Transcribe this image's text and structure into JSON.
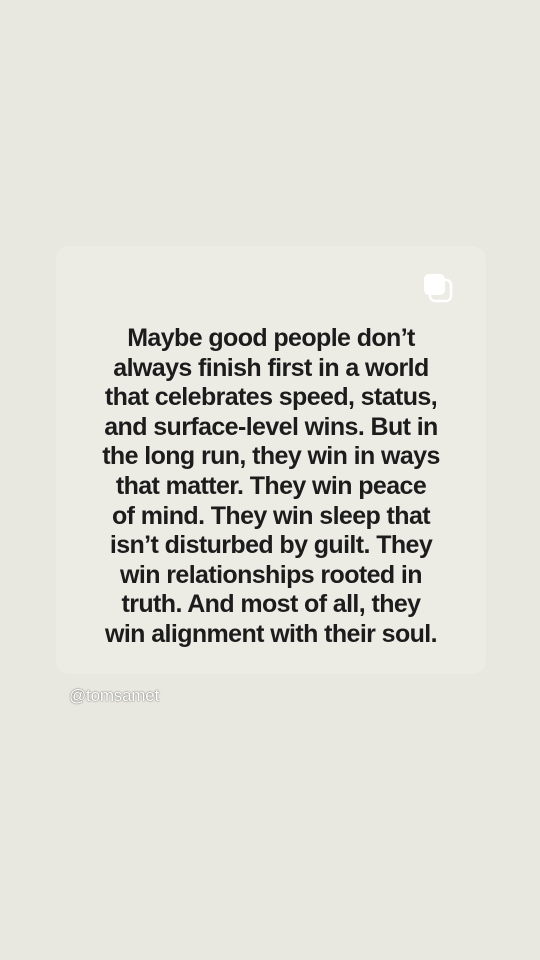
{
  "post": {
    "carousel_icon": "multiple-images-icon",
    "quote_lines": [
      "Maybe good people don’t",
      "always finish first in a world",
      "that celebrates speed, status,",
      "and surface-level wins. But in",
      "the long run, they win in ways",
      "that matter. They win peace",
      "of mind. They win sleep that",
      "isn’t disturbed by guilt. They",
      "win relationships rooted in",
      "truth. And most of all, they",
      "win alignment with their soul."
    ]
  },
  "overlay": {
    "handle": "@tomsamet"
  },
  "colors": {
    "background": "#e9e8e0",
    "card": "#edece4",
    "text": "#1c1c1c",
    "handle_text": "#ffffff"
  }
}
